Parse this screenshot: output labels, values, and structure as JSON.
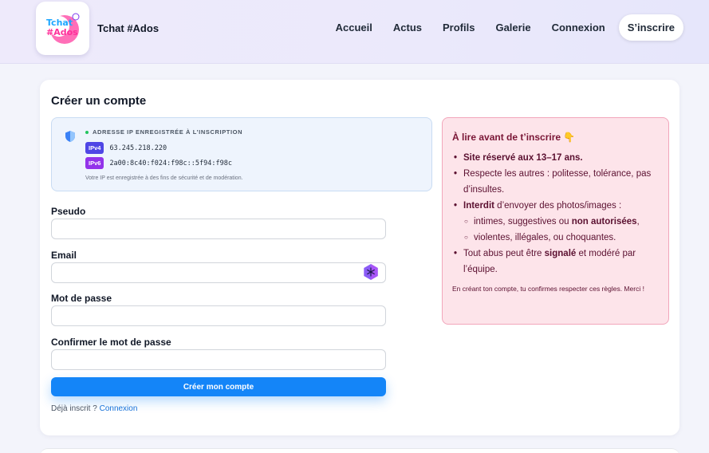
{
  "brand": {
    "name": "Tchat #Ados",
    "logo_text": "Tchat #Ados"
  },
  "nav": {
    "items": [
      "Accueil",
      "Actus",
      "Profils",
      "Galerie",
      "Connexion"
    ],
    "signup": "S’inscrire"
  },
  "form": {
    "title": "Créer un compte",
    "ip": {
      "header": "ADRESSE IP ENREGISTRÉE À L’INSCRIPTION",
      "v4_label": "IPv4",
      "v4_value": "63.245.218.220",
      "v6_label": "IPv6",
      "v6_value": "2a00:8c40:f024:f98c::5f94:f98c",
      "note": "Votre IP est enregistrée à des fins de sécurité et de modération."
    },
    "fields": {
      "pseudo": {
        "label": "Pseudo",
        "value": ""
      },
      "email": {
        "label": "Email",
        "value": ""
      },
      "password": {
        "label": "Mot de passe",
        "value": ""
      },
      "confirm": {
        "label": "Confirmer le mot de passe",
        "value": ""
      }
    },
    "submit": "Créer mon compte",
    "login_prompt": "Déjà inscrit ?",
    "login_link": "Connexion"
  },
  "rules": {
    "title": "À lire avant de t’inscrire 👇",
    "items": [
      {
        "bold": "Site réservé aux 13–17 ans.",
        "text": ""
      },
      {
        "bold": "",
        "text": "Respecte les autres : politesse, tolérance, pas d’insultes."
      },
      {
        "bold": "Interdit",
        "text": " d’envoyer des photos/images :"
      },
      {
        "sub1_pre": "intimes, suggestives ou ",
        "sub1_bold": "non autorisées",
        "sub1_post": ","
      },
      {
        "sub2": "violentes, illégales, ou choquantes."
      },
      {
        "pre": "Tout abus peut être ",
        "bold": "signalé",
        "post": " et modéré par l’équipe."
      }
    ],
    "footer": "En créant ton compte, tu confirmes respecter ces règles. Merci !"
  },
  "colors": {
    "accent": "#1485f8",
    "ipv4_badge": "#4f46e5",
    "ipv6_badge": "#9333ea",
    "rules_bg": "#fde4ea",
    "rules_border": "#f2a6bb"
  }
}
